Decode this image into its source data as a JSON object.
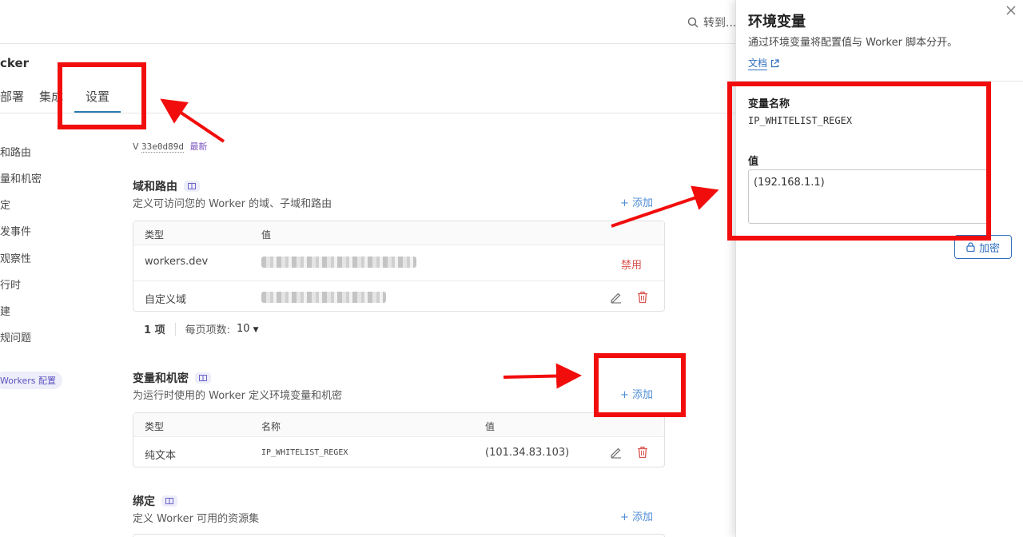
{
  "topbar": {
    "search_label": "转到..."
  },
  "worker": {
    "title_partial": "cker"
  },
  "tabs": [
    {
      "label": "部署"
    },
    {
      "label": "集成"
    },
    {
      "label": "设置"
    }
  ],
  "sidenav": {
    "items": [
      "域和路由",
      "变量和机密",
      "绑定",
      "触发事件",
      "可观察性",
      "运行时",
      "构建",
      "常规问题"
    ],
    "badge": "Workers 配置"
  },
  "version": {
    "prefix": "V",
    "hash": "33e0d89d",
    "latest": "最新"
  },
  "sections": {
    "domains": {
      "title": "域和路由",
      "subtitle": "定义可访问您的 Worker 的域、子域和路由",
      "add": "+ 添加",
      "columns": [
        "类型",
        "值"
      ],
      "rows": [
        {
          "type": "workers.dev",
          "action": "禁用"
        },
        {
          "type": "自定义域"
        }
      ],
      "pager": {
        "count": "1 项",
        "per_page_label": "每页项数:",
        "per_page": "10"
      }
    },
    "variables": {
      "title": "变量和机密",
      "subtitle": "为运行时使用的 Worker 定义环境变量和机密",
      "add": "+ 添加",
      "columns": [
        "类型",
        "名称",
        "值"
      ],
      "rows": [
        {
          "type": "纯文本",
          "name": "IP_WHITELIST_REGEX",
          "value": "(101.34.83.103)"
        }
      ]
    },
    "bindings": {
      "title": "绑定",
      "subtitle": "定义 Worker 可用的资源集",
      "add": "+ 添加"
    }
  },
  "panel": {
    "title": "环境变量",
    "subtitle": "通过环境变量将配置值与 Worker 脚本分开。",
    "doc_link": "文档",
    "name_label": "变量名称",
    "name_value": "IP_WHITELIST_REGEX",
    "value_label": "值",
    "value_text": "(192.168.1.1)",
    "encrypt": "加密"
  },
  "colors": {
    "accent": "#2f6fbd",
    "danger": "#d9534f",
    "annotation": "#f20d0d",
    "badge": "#5d52c0"
  }
}
